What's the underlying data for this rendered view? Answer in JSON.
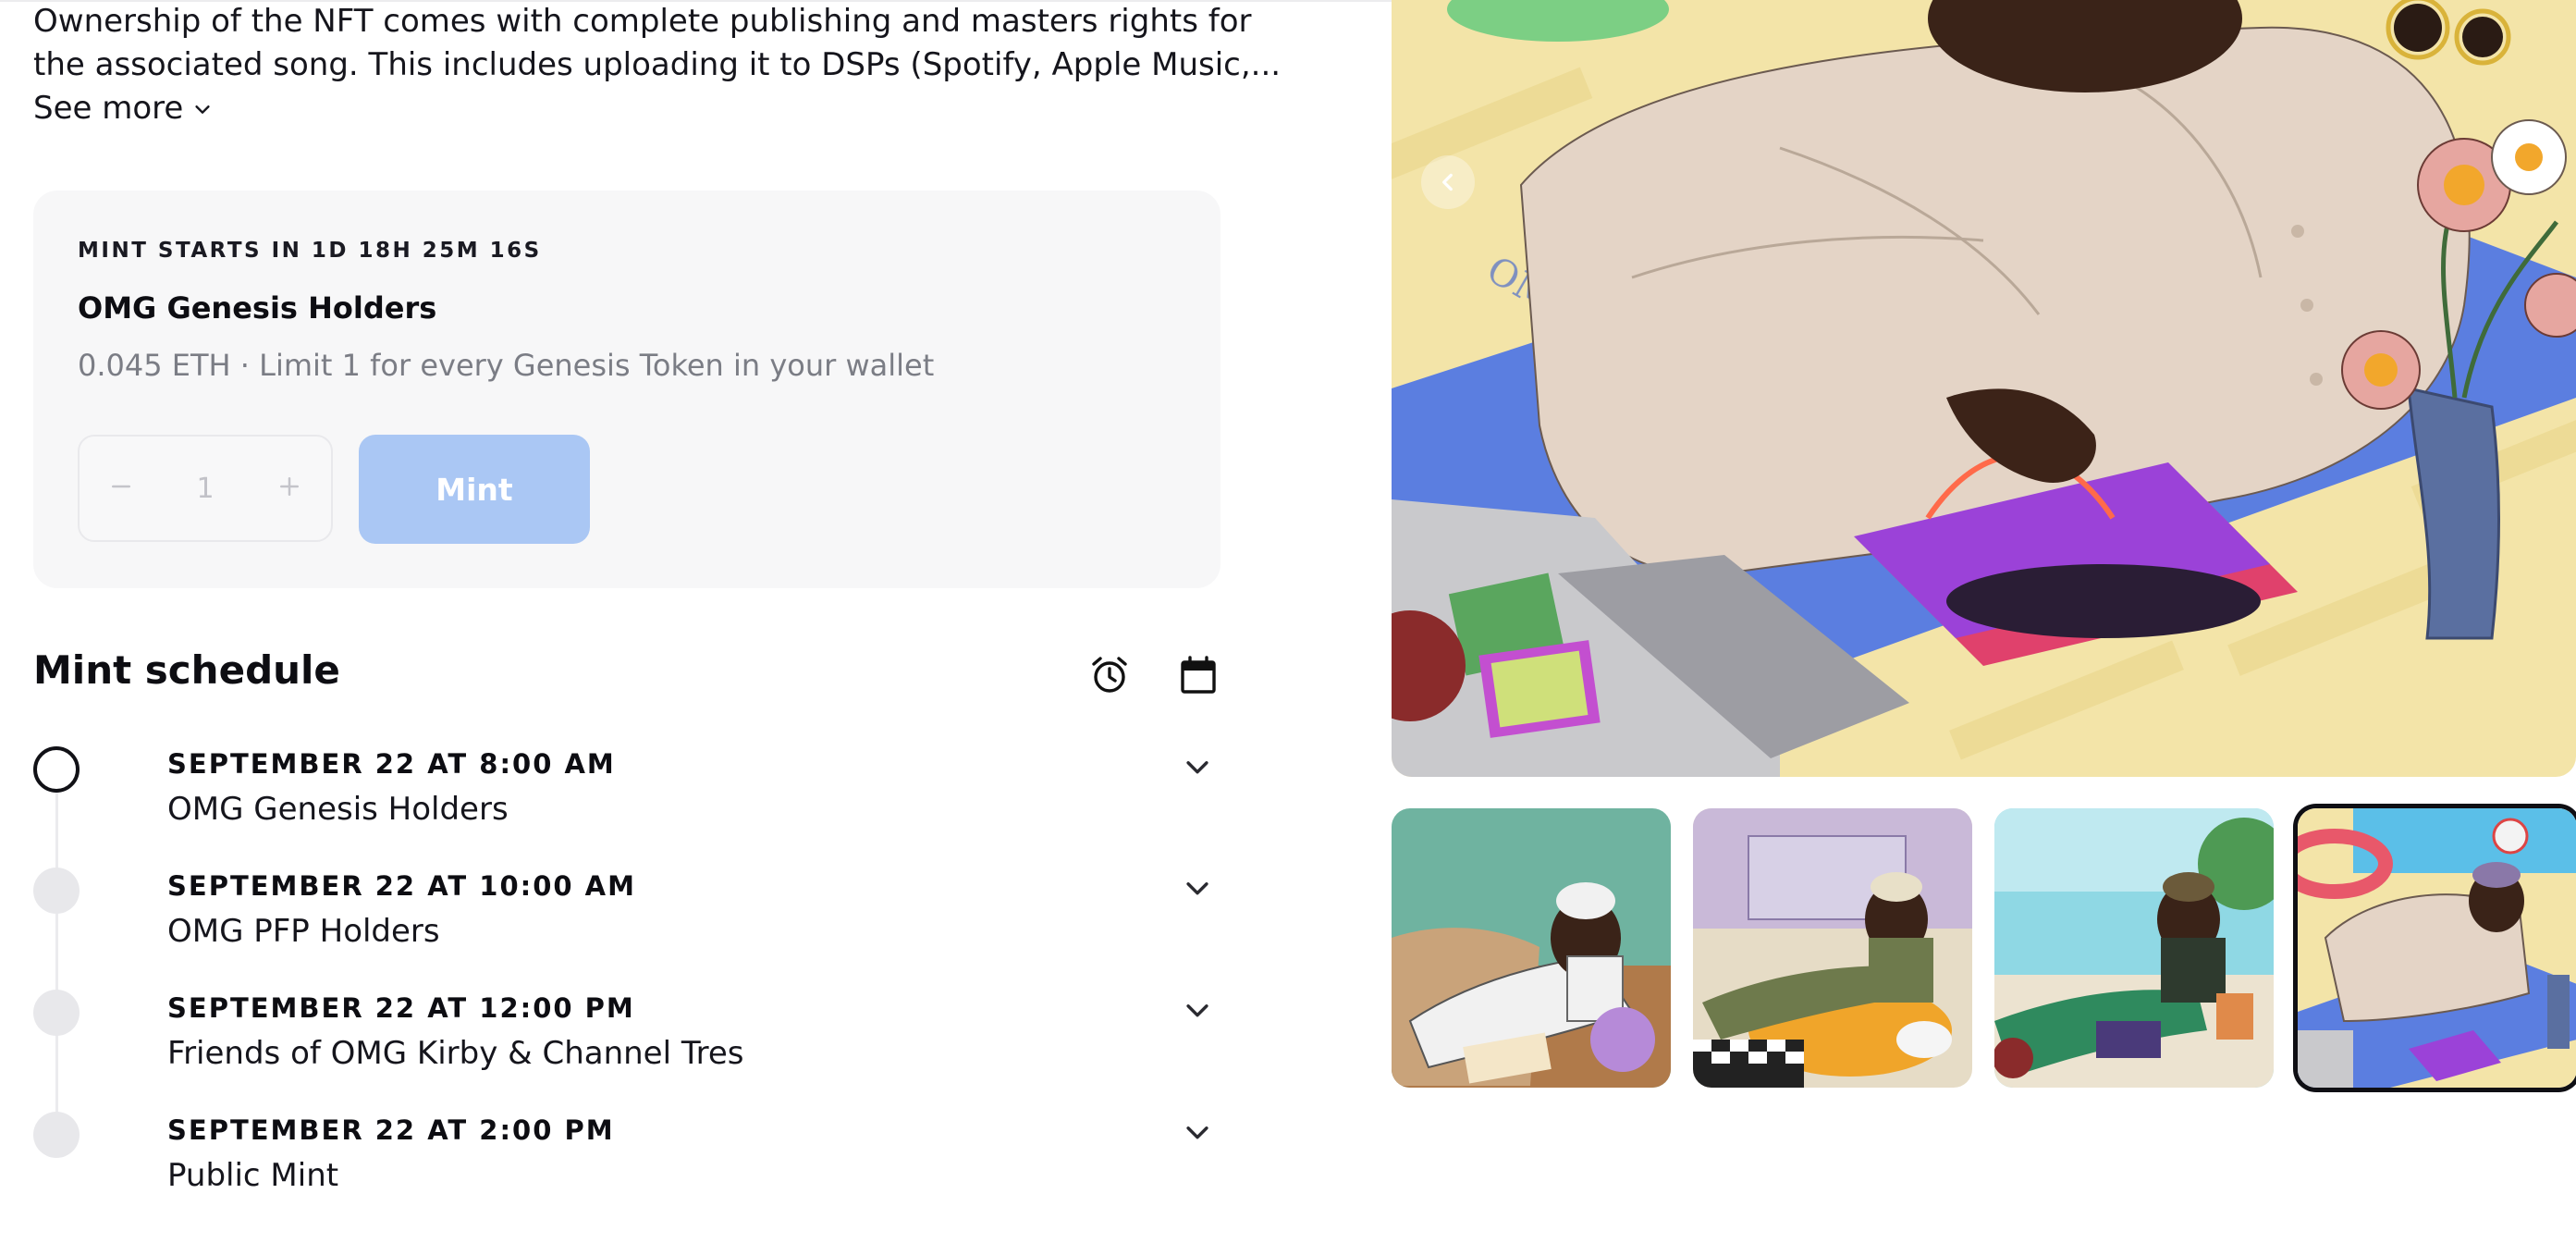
{
  "description": {
    "line1": "Ownership of the NFT comes with complete publishing and masters rights for",
    "line2": "the associated song. This includes uploading it to DSPs (Spotify, Apple Music,...",
    "see_more": "See more"
  },
  "mint_card": {
    "countdown": "MINT STARTS IN 1D 18H 25M 16S",
    "phase_name": "OMG Genesis Holders",
    "price_line": "0.045 ETH · Limit 1 for every Genesis Token in your wallet",
    "quantity": "1",
    "mint_label": "Mint"
  },
  "schedule": {
    "title": "Mint schedule",
    "icons": [
      "alarm-clock-icon",
      "calendar-icon"
    ],
    "items": [
      {
        "date": "SEPTEMBER 22 AT 8:00 AM",
        "name": "OMG Genesis Holders",
        "state": "active"
      },
      {
        "date": "SEPTEMBER 22 AT 10:00 AM",
        "name": "OMG PFP Holders",
        "state": "upcoming"
      },
      {
        "date": "SEPTEMBER 22 AT 12:00 PM",
        "name": "Friends of OMG Kirby & Channel Tres",
        "state": "upcoming"
      },
      {
        "date": "SEPTEMBER 22 AT 2:00 PM",
        "name": "Public Mint",
        "state": "upcoming"
      }
    ]
  },
  "gallery": {
    "thumbnail_count": 4,
    "selected_index": 3
  },
  "colors": {
    "card_bg": "#f7f7f8",
    "mint_button_disabled": "#aac7f4",
    "text": "#0d0d12",
    "muted": "#7b7d85"
  }
}
